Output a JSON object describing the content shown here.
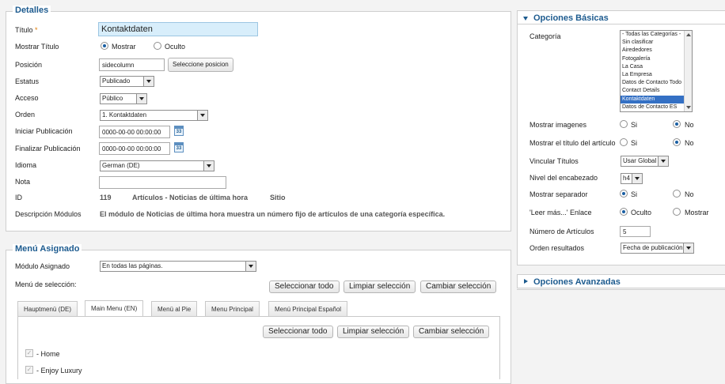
{
  "details": {
    "legend": "Detalles",
    "title_label": "Título",
    "title_required": "*",
    "title_value": "Kontaktdaten",
    "show_title_label": "Mostrar Título",
    "show_title_options": [
      "Mostrar",
      "Oculto"
    ],
    "position_label": "Posición",
    "position_value": "sidecolumn",
    "position_button": "Seleccione posicion",
    "status_label": "Estatus",
    "status_value": "Publicado",
    "access_label": "Acceso",
    "access_value": "Público",
    "order_label": "Orden",
    "order_value": "1. Kontaktdaten",
    "publish_up_label": "Iniciar Publicación",
    "publish_up_value": "0000-00-00 00:00:00",
    "publish_down_label": "Finalizar Publicación",
    "publish_down_value": "0000-00-00 00:00:00",
    "calendar_day": "33",
    "language_label": "Idioma",
    "language_value": "German (DE)",
    "note_label": "Nota",
    "note_value": "",
    "id_label": "ID",
    "id_value": "119",
    "module_type": "Artículos - Noticias de última hora",
    "client": "Sitio",
    "description_label": "Descripción Módulos",
    "description_value": "El módulo de Noticias de última hora muestra un número fijo de artículos de una categoría específica."
  },
  "menu_assignment": {
    "legend": "Menú Asignado",
    "assigned_label": "Módulo Asignado",
    "assigned_value": "En todas las páginas.",
    "selection_label": "Menú de selección:",
    "buttons": [
      "Seleccionar todo",
      "Limpiar selección",
      "Cambiar selección"
    ],
    "tabs": [
      "Hauptmenü (DE)",
      "Main Menu (EN)",
      "Menü al Pie",
      "Menu Principal",
      "Menú Principal Español"
    ],
    "active_tab": "Main Menu (EN)",
    "inner_buttons": [
      "Seleccionar todo",
      "Limpiar selección",
      "Cambiar selección"
    ],
    "items": [
      {
        "label": "- Home",
        "checked": true
      },
      {
        "label": "- Enjoy Luxury",
        "checked": true
      }
    ]
  },
  "basic_options": {
    "heading": "Opciones Básicas",
    "category_label": "Categoría",
    "categories": [
      "- Todas las Categorías -",
      "Sin clasificar",
      "Airededores",
      "Fotogalería",
      "La Casa",
      "La Empresa",
      "Datos de Contacto Todo",
      "Contact Details",
      "Kontaktdaten",
      "Datos de Contacto ES"
    ],
    "selected_category": "Kontaktdaten",
    "show_images_label": "Mostrar imagenes",
    "show_images_options": [
      "Si",
      "No"
    ],
    "show_images_value": "No",
    "show_article_title_label": "Mostrar el título del artículo",
    "show_article_title_options": [
      "Si",
      "No"
    ],
    "show_article_title_value": "No",
    "link_titles_label": "Vincular Títulos",
    "link_titles_value": "Usar Global",
    "header_level_label": "Nivel del encabezado",
    "header_level_value": "h4",
    "show_separator_label": "Mostrar separador",
    "show_separator_options": [
      "Si",
      "No"
    ],
    "show_separator_value": "Si",
    "readmore_label": "'Leer más...' Enlace",
    "readmore_options": [
      "Oculto",
      "Mostrar"
    ],
    "readmore_value": "Oculto",
    "count_label": "Número de Artículos",
    "count_value": "5",
    "ordering_label": "Orden resultados",
    "ordering_value": "Fecha de publicación"
  },
  "advanced_options": {
    "heading": "Opciones Avanzadas"
  },
  "colors": {
    "heading": "#1d5b8f",
    "title_field": "#d8eefb",
    "required": "#e07b00",
    "selected_option": "#3470c4"
  }
}
